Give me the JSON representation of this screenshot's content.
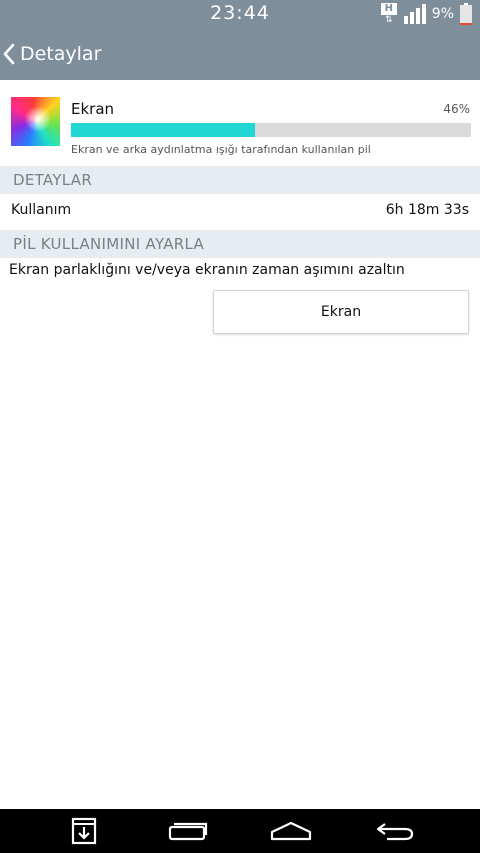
{
  "status_bar": {
    "time": "23:44",
    "network_badge": "H",
    "signal_bars": 4,
    "battery_percent": "9%",
    "battery_level": 0.09,
    "colors": {
      "battery_low": "#e84b2a"
    }
  },
  "app_bar": {
    "back_icon": "chevron-left-icon",
    "title": "Detaylar",
    "background": "#7f8e9b"
  },
  "usage_item": {
    "icon": "display-color-icon",
    "name": "Ekran",
    "percent_label": "46%",
    "percent_value": 0.46,
    "description": "Ekran ve arka aydınlatma ışığı tarafından kullanılan pil",
    "colors": {
      "bar_fill": "#22d6d3",
      "bar_track": "#dadada"
    }
  },
  "details_section": {
    "header": "DETAYLAR",
    "rows": [
      {
        "label": "Kullanım",
        "value": "6h 18m 33s"
      }
    ]
  },
  "adjust_section": {
    "header": "PİL KULLANIMINI AYARLA",
    "hint": "Ekran parlaklığını ve/veya ekranın zaman aşımını azaltın",
    "button_label": "Ekran"
  },
  "nav_bar": {
    "buttons": [
      "notification-drawer-icon",
      "recent-apps-icon",
      "home-icon",
      "back-icon"
    ]
  }
}
